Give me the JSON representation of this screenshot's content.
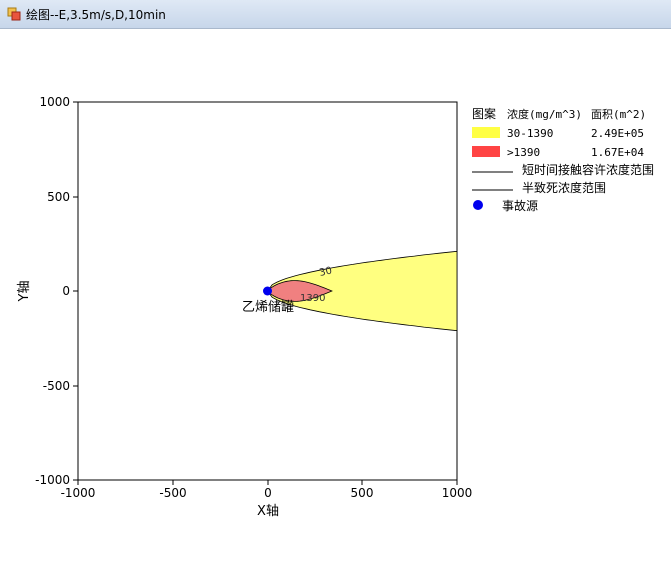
{
  "window": {
    "title": "绘图--E,3.5m/s,D,10min"
  },
  "plot": {
    "x_ticks": [
      "-1000",
      "-500",
      "0",
      "500",
      "1000"
    ],
    "y_ticks": [
      "1000",
      "500",
      "0",
      "-500",
      "-1000"
    ],
    "xlabel": "X轴",
    "ylabel": "Y轴",
    "source_label": "乙烯储罐",
    "contour_labels": {
      "outer": "30",
      "inner": "1390"
    }
  },
  "legend": {
    "header": {
      "pattern": "图案",
      "concentration": "浓度(mg/m^3)",
      "area": "面积(m^2)"
    },
    "rows": [
      {
        "range": "30-1390",
        "area": "2.49E+05",
        "color": "#ffff66"
      },
      {
        "range": ">1390",
        "area": "1.67E+04",
        "color": "#ff4444"
      }
    ],
    "line_items": [
      "短时间接触容许浓度范围",
      "半致死浓度范围"
    ],
    "source_item": "事故源",
    "source_color": "#0000ee"
  },
  "chart_data": {
    "type": "contour",
    "x_range": [
      -1000,
      1000
    ],
    "y_range": [
      -1000,
      1000
    ],
    "source_point": {
      "x": 0,
      "y": 0
    },
    "plume_outer": {
      "level": "30",
      "x_start": 0,
      "x_end": 1000,
      "half_width_at_end": 210,
      "color": "#ffff80"
    },
    "plume_inner": {
      "level": "1390",
      "x_start": 0,
      "x_end": 340,
      "half_width_max": 55,
      "color": "#f08080"
    }
  }
}
